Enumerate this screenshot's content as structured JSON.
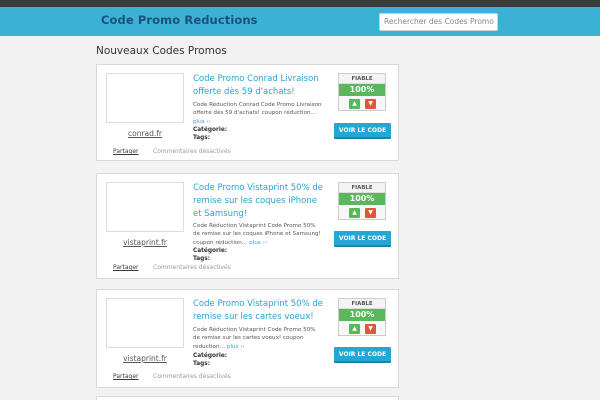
{
  "header": {
    "site_title": "Code Promo Reductions",
    "search_placeholder": "Rechercher des Codes Promo"
  },
  "section_title": "Nouveaux Codes Promos",
  "cards": [
    {
      "merchant": "conrad.fr",
      "title": "Code Promo Conrad Livraison offerte dès 59 d'achats!",
      "description": "Code Réduction Conrad Code Promo Livraison offerte dès 59 d'achats! coupon réduction…",
      "more": "plus ››",
      "category_label": "Catégorie:",
      "tags_label": "Tags:",
      "share": "Partager",
      "comments": "Commentaires désactivés",
      "reliability_label": "FIABLE",
      "reliability": "100%",
      "button": "VOIR LE CODE"
    },
    {
      "merchant": "vistaprint.fr",
      "title": "Code Promo Vistaprint 50% de remise sur les coques iPhone et Samsung!",
      "description": "Code Réduction Vistaprint Code Promo 50% de remise sur les coques iPhone et Samsung! coupon réduction…",
      "more": "plus ››",
      "category_label": "Catégorie:",
      "tags_label": "Tags:",
      "share": "Partager",
      "comments": "Commentaires désactivés",
      "reliability_label": "FIABLE",
      "reliability": "100%",
      "button": "VOIR LE CODE"
    },
    {
      "merchant": "vistaprint.fr",
      "title": "Code Promo Vistaprint 50% de remise sur les cartes voeux!",
      "description": "Code Réduction Vistaprint Code Promo 50% de remise sur les cartes voeux! coupon réduction…",
      "more": "plus ››",
      "category_label": "Catégorie:",
      "tags_label": "Tags:",
      "share": "Partager",
      "comments": "Commentaires désactivés",
      "reliability_label": "FIABLE",
      "reliability": "100%",
      "button": "VOIR LE CODE"
    }
  ],
  "icons": {
    "thumb_up": "thumbs-up-icon",
    "thumb_down": "thumbs-down-icon"
  },
  "colors": {
    "header": "#3bb1d6",
    "accent": "#2aa3cf",
    "green": "#5bb75b",
    "red": "#e0563b"
  }
}
